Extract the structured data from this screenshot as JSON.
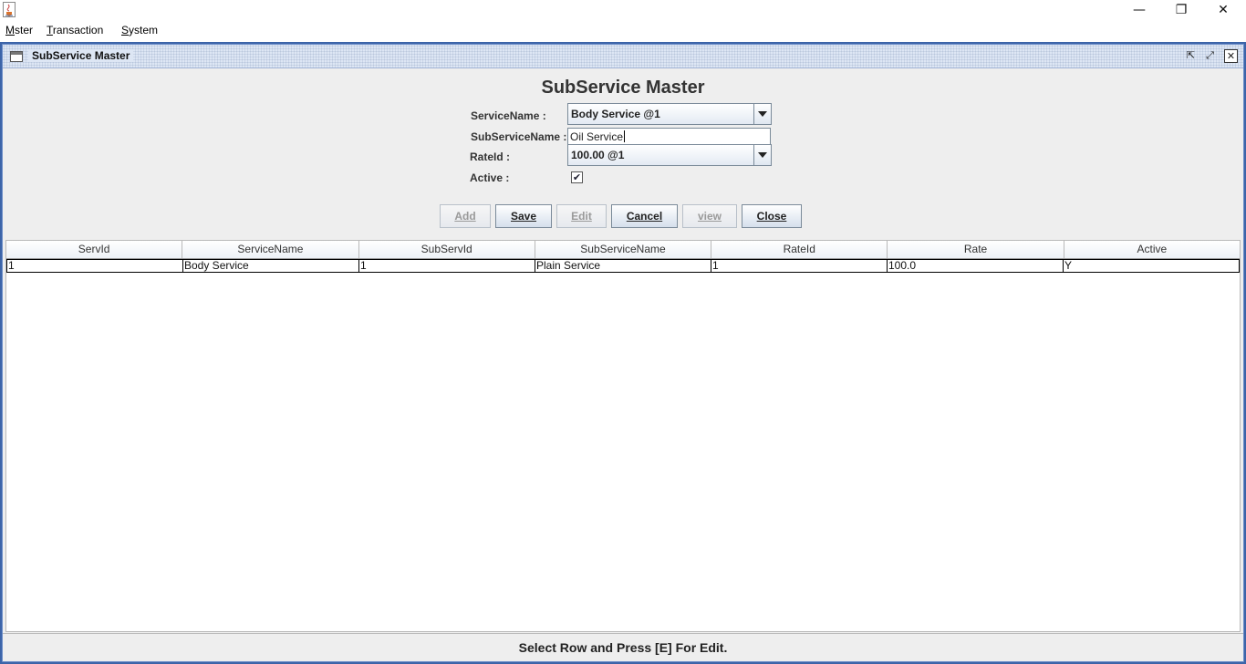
{
  "window": {
    "minimize_glyph": "—",
    "maximize_glyph": "❐",
    "close_glyph": "✕"
  },
  "menu": [
    {
      "mnemonic": "M",
      "rest": "ster"
    },
    {
      "mnemonic": "T",
      "rest": "ransaction"
    },
    {
      "mnemonic": "S",
      "rest": "ystem"
    }
  ],
  "frame": {
    "title": "SubService Master",
    "iconify_glyph": "⇱",
    "maximize_glyph": "⤢",
    "close_glyph": "✕"
  },
  "form": {
    "title": "SubService Master",
    "service_label": "ServiceName :",
    "service_value": "Body Service @1",
    "subservice_label": "SubServiceName :",
    "subservice_value": "Oil Service",
    "rate_label": "RateId :",
    "rate_value": "100.00 @1",
    "active_label": "Active :",
    "active_checked": true,
    "check_glyph": "✔"
  },
  "buttons": [
    {
      "label": "Add",
      "enabled": false
    },
    {
      "label": "Save",
      "enabled": true
    },
    {
      "label": "Edit",
      "enabled": false
    },
    {
      "label": "Cancel",
      "enabled": true
    },
    {
      "label": "view",
      "enabled": false
    },
    {
      "label": "Close",
      "enabled": true
    }
  ],
  "table": {
    "columns": [
      "ServId",
      "ServiceName",
      "SubServId",
      "SubServiceName",
      "RateId",
      "Rate",
      "Active"
    ],
    "rows": [
      [
        "1",
        "Body Service",
        "1",
        "Plain Service",
        "1",
        "100.0",
        "Y"
      ]
    ]
  },
  "status": "Select Row and Press [E] For Edit.",
  "colors": {
    "desktop": "#3c64a8",
    "panel": "#eeeeee"
  },
  "icons": [
    "java-cup-icon",
    "frame-window-icon",
    "combo-arrow-icon",
    "checkbox-check-icon"
  ]
}
